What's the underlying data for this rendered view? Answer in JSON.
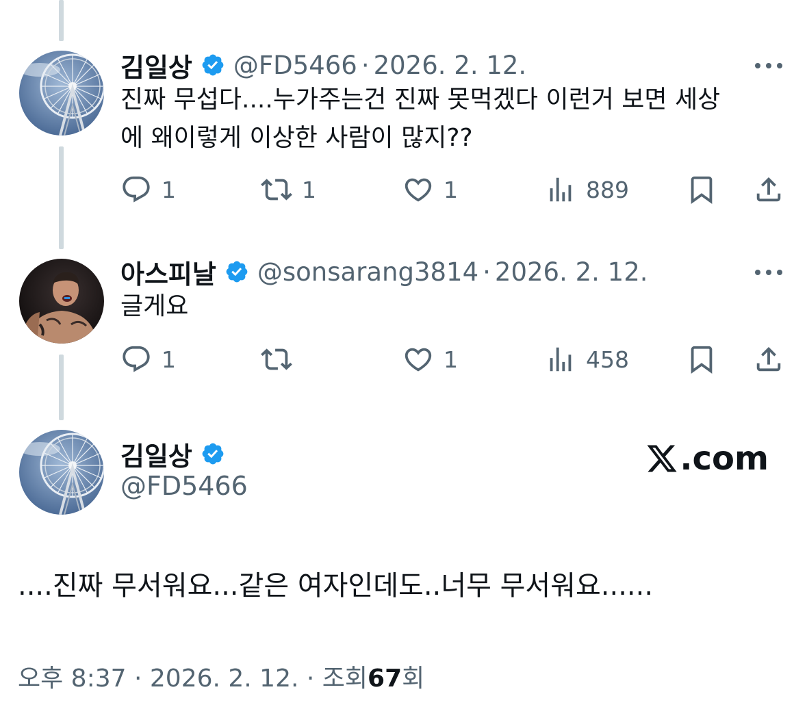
{
  "replies": [
    {
      "display_name": "김일상",
      "handle": "@FD5466",
      "separator": "·",
      "date": "2026. 2. 12.",
      "text_lines": [
        "진짜 무섭다....누가주는건 진짜 못먹겠다 이런거 보면 세상",
        "에 왜이렇게 이상한 사람이 많지??"
      ],
      "counts": {
        "replies": "1",
        "reposts": "1",
        "likes": "1",
        "views": "889"
      },
      "avatar_icon": "ferris-wheel-avatar"
    },
    {
      "display_name": "아스피날",
      "handle": "@sonsarang3814",
      "separator": "·",
      "date": "2026. 2. 12.",
      "text_lines": [
        "글게요"
      ],
      "counts": {
        "replies": "1",
        "reposts": "",
        "likes": "1",
        "views": "458"
      },
      "avatar_icon": "fighter-avatar"
    }
  ],
  "main_tweet": {
    "display_name": "김일상",
    "handle": "@FD5466",
    "brand": ".com",
    "brand_icon": "x-logo-icon",
    "text": "....진짜 무서워요...같은 여자인데도..너무 무서워요......",
    "footer": {
      "time": "오후 8:37",
      "separator": "·",
      "date": "2026. 2. 12.",
      "views_label": "조회",
      "views_count": "67",
      "views_suffix": "회"
    }
  },
  "colors": {
    "verified": "#1d9bf0",
    "secondary_text": "#536471",
    "thread_line": "#cfd9de"
  }
}
